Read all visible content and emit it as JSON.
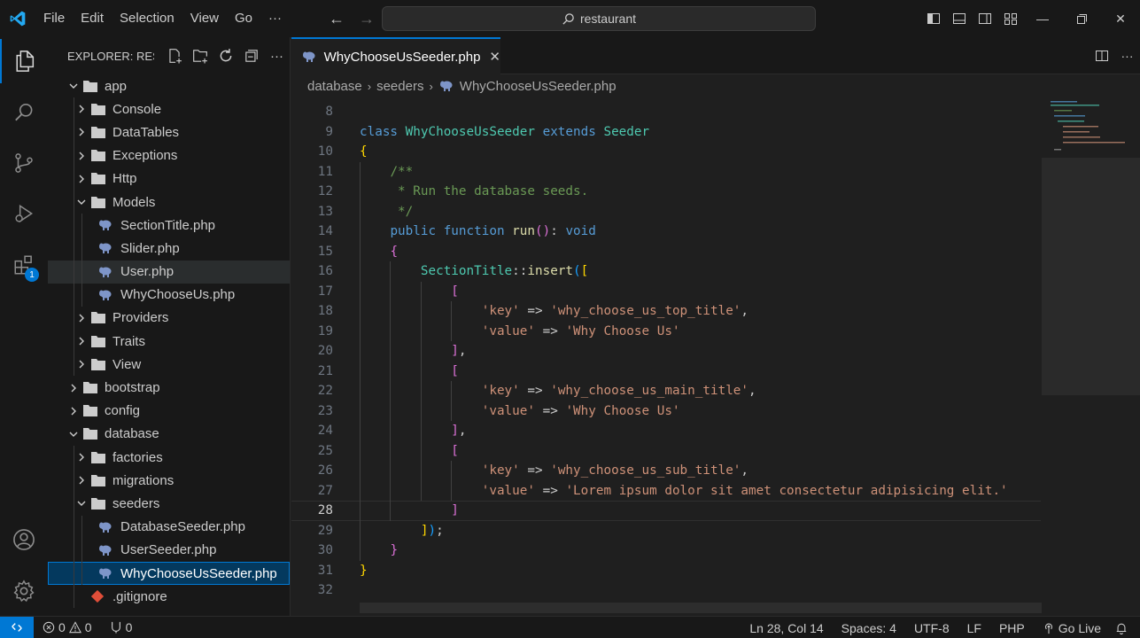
{
  "titlebar": {
    "menus": [
      "File",
      "Edit",
      "Selection",
      "View",
      "Go"
    ],
    "more": "···",
    "search": "restaurant"
  },
  "activity": {
    "extensions_badge": "1"
  },
  "sidebar": {
    "title": "EXPLORER: RESTAURANT",
    "items": [
      {
        "label": "app",
        "type": "folder",
        "depth": 0,
        "open": true
      },
      {
        "label": "Console",
        "type": "folder",
        "depth": 1,
        "open": false
      },
      {
        "label": "DataTables",
        "type": "folder",
        "depth": 1,
        "open": false
      },
      {
        "label": "Exceptions",
        "type": "folder",
        "depth": 1,
        "open": false
      },
      {
        "label": "Http",
        "type": "folder",
        "depth": 1,
        "open": false
      },
      {
        "label": "Models",
        "type": "folder",
        "depth": 1,
        "open": true
      },
      {
        "label": "SectionTitle.php",
        "type": "php",
        "depth": 2
      },
      {
        "label": "Slider.php",
        "type": "php",
        "depth": 2
      },
      {
        "label": "User.php",
        "type": "php",
        "depth": 2,
        "state": "hover"
      },
      {
        "label": "WhyChooseUs.php",
        "type": "php",
        "depth": 2
      },
      {
        "label": "Providers",
        "type": "folder",
        "depth": 1,
        "open": false
      },
      {
        "label": "Traits",
        "type": "folder",
        "depth": 1,
        "open": false
      },
      {
        "label": "View",
        "type": "folder",
        "depth": 1,
        "open": false
      },
      {
        "label": "bootstrap",
        "type": "folder",
        "depth": 0,
        "open": false
      },
      {
        "label": "config",
        "type": "folder",
        "depth": 0,
        "open": false
      },
      {
        "label": "database",
        "type": "folder",
        "depth": 0,
        "open": true
      },
      {
        "label": "factories",
        "type": "folder",
        "depth": 1,
        "open": false
      },
      {
        "label": "migrations",
        "type": "folder",
        "depth": 1,
        "open": false
      },
      {
        "label": "seeders",
        "type": "folder",
        "depth": 1,
        "open": true
      },
      {
        "label": "DatabaseSeeder.php",
        "type": "php",
        "depth": 2
      },
      {
        "label": "UserSeeder.php",
        "type": "php",
        "depth": 2
      },
      {
        "label": "WhyChooseUsSeeder.php",
        "type": "php",
        "depth": 2,
        "state": "selected"
      },
      {
        "label": ".gitignore",
        "type": "git",
        "depth": 1
      }
    ]
  },
  "editor": {
    "tab": "WhyChooseUsSeeder.php",
    "breadcrumb": [
      "database",
      "seeders",
      "WhyChooseUsSeeder.php"
    ],
    "active_line": 28,
    "lines": [
      {
        "n": 8,
        "tokens": []
      },
      {
        "n": 9,
        "tokens": [
          [
            "k",
            "class "
          ],
          [
            "cls",
            "WhyChooseUsSeeder "
          ],
          [
            "k",
            "extends "
          ],
          [
            "cls",
            "Seeder"
          ]
        ]
      },
      {
        "n": 10,
        "tokens": [
          [
            "b1",
            "{"
          ]
        ]
      },
      {
        "n": 11,
        "tokens": [
          [
            "pn",
            "    "
          ],
          [
            "cm",
            "/**"
          ]
        ]
      },
      {
        "n": 12,
        "tokens": [
          [
            "pn",
            "    "
          ],
          [
            "cm",
            " * Run the database seeds."
          ]
        ]
      },
      {
        "n": 13,
        "tokens": [
          [
            "pn",
            "    "
          ],
          [
            "cm",
            " */"
          ]
        ]
      },
      {
        "n": 14,
        "tokens": [
          [
            "pn",
            "    "
          ],
          [
            "k",
            "public function "
          ],
          [
            "fn",
            "run"
          ],
          [
            "b2",
            "()"
          ],
          [
            "pn",
            ": "
          ],
          [
            "k",
            "void"
          ]
        ]
      },
      {
        "n": 15,
        "tokens": [
          [
            "pn",
            "    "
          ],
          [
            "b2",
            "{"
          ]
        ]
      },
      {
        "n": 16,
        "tokens": [
          [
            "pn",
            "        "
          ],
          [
            "cls",
            "SectionTitle"
          ],
          [
            "pn",
            "::"
          ],
          [
            "fn",
            "insert"
          ],
          [
            "b3",
            "("
          ],
          [
            "b1",
            "["
          ]
        ]
      },
      {
        "n": 17,
        "tokens": [
          [
            "pn",
            "            "
          ],
          [
            "b2",
            "["
          ]
        ]
      },
      {
        "n": 18,
        "tokens": [
          [
            "pn",
            "                "
          ],
          [
            "str",
            "'key'"
          ],
          [
            "pn",
            " => "
          ],
          [
            "str",
            "'why_choose_us_top_title'"
          ],
          [
            "pn",
            ","
          ]
        ]
      },
      {
        "n": 19,
        "tokens": [
          [
            "pn",
            "                "
          ],
          [
            "str",
            "'value'"
          ],
          [
            "pn",
            " => "
          ],
          [
            "str",
            "'Why Choose Us'"
          ]
        ]
      },
      {
        "n": 20,
        "tokens": [
          [
            "pn",
            "            "
          ],
          [
            "b2",
            "]"
          ],
          [
            "pn",
            ","
          ]
        ]
      },
      {
        "n": 21,
        "tokens": [
          [
            "pn",
            "            "
          ],
          [
            "b2",
            "["
          ]
        ]
      },
      {
        "n": 22,
        "tokens": [
          [
            "pn",
            "                "
          ],
          [
            "str",
            "'key'"
          ],
          [
            "pn",
            " => "
          ],
          [
            "str",
            "'why_choose_us_main_title'"
          ],
          [
            "pn",
            ","
          ]
        ]
      },
      {
        "n": 23,
        "tokens": [
          [
            "pn",
            "                "
          ],
          [
            "str",
            "'value'"
          ],
          [
            "pn",
            " => "
          ],
          [
            "str",
            "'Why Choose Us'"
          ]
        ]
      },
      {
        "n": 24,
        "tokens": [
          [
            "pn",
            "            "
          ],
          [
            "b2",
            "]"
          ],
          [
            "pn",
            ","
          ]
        ]
      },
      {
        "n": 25,
        "tokens": [
          [
            "pn",
            "            "
          ],
          [
            "b2",
            "["
          ]
        ]
      },
      {
        "n": 26,
        "tokens": [
          [
            "pn",
            "                "
          ],
          [
            "str",
            "'key'"
          ],
          [
            "pn",
            " => "
          ],
          [
            "str",
            "'why_choose_us_sub_title'"
          ],
          [
            "pn",
            ","
          ]
        ]
      },
      {
        "n": 27,
        "tokens": [
          [
            "pn",
            "                "
          ],
          [
            "str",
            "'value'"
          ],
          [
            "pn",
            " => "
          ],
          [
            "str",
            "'Lorem ipsum dolor sit amet consectetur adipisicing elit.'"
          ]
        ]
      },
      {
        "n": 28,
        "tokens": [
          [
            "pn",
            "            "
          ],
          [
            "b2",
            "]"
          ]
        ]
      },
      {
        "n": 29,
        "tokens": [
          [
            "pn",
            "        "
          ],
          [
            "b1",
            "]"
          ],
          [
            "b3",
            ")"
          ],
          [
            "pn",
            ";"
          ]
        ]
      },
      {
        "n": 30,
        "tokens": [
          [
            "pn",
            "    "
          ],
          [
            "b2",
            "}"
          ]
        ]
      },
      {
        "n": 31,
        "tokens": [
          [
            "b1",
            "}"
          ]
        ]
      },
      {
        "n": 32,
        "tokens": []
      }
    ]
  },
  "status": {
    "errors": "0",
    "warnings": "0",
    "ports": "0",
    "position": "Ln 28, Col 14",
    "spaces": "Spaces: 4",
    "encoding": "UTF-8",
    "eol": "LF",
    "language": "PHP",
    "golive": "Go Live"
  },
  "colors": {
    "accent": "#0078d4",
    "php_icon": "#7e95c8",
    "git_icon": "#e04e39"
  }
}
